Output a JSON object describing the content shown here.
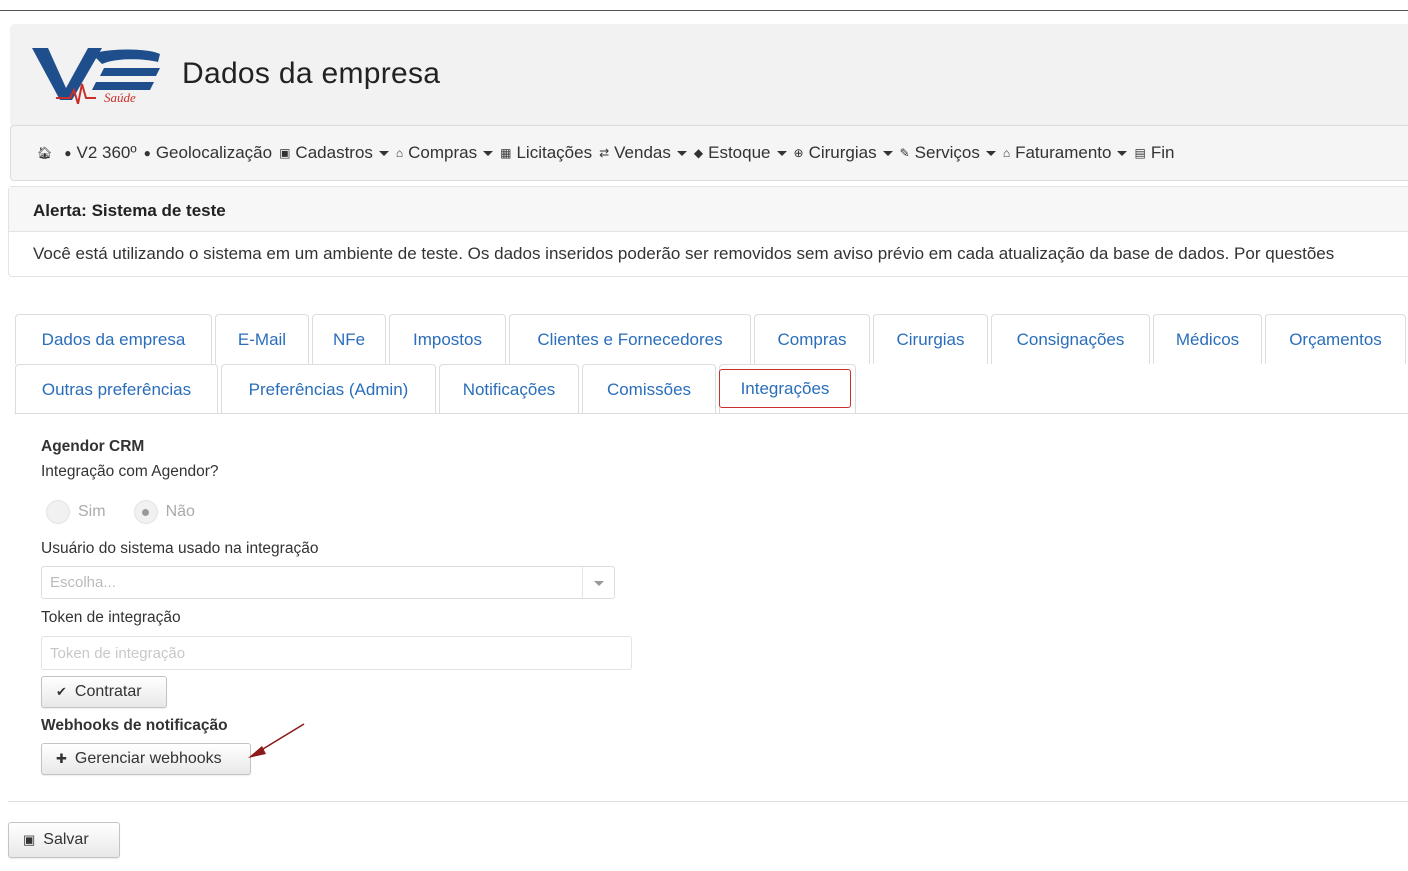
{
  "header": {
    "title": "Dados da empresa",
    "logo_text": "V2 Saúde"
  },
  "navbar": {
    "items": [
      {
        "icon": "home-icon",
        "label": ""
      },
      {
        "icon": "globe-icon",
        "label": "V2 360º"
      },
      {
        "icon": "globe-icon",
        "label": "Geolocalização"
      },
      {
        "icon": "save-icon",
        "label": "Cadastros"
      },
      {
        "icon": "bank-icon",
        "label": "Compras"
      },
      {
        "icon": "building-icon",
        "label": "Licitações"
      },
      {
        "icon": "transfer-icon",
        "label": "Vendas"
      },
      {
        "icon": "tag-icon",
        "label": "Estoque"
      },
      {
        "icon": "plus-circle-icon",
        "label": "Cirurgias"
      },
      {
        "icon": "wrench-icon",
        "label": "Serviços"
      },
      {
        "icon": "bank-icon",
        "label": "Faturamento"
      },
      {
        "icon": "table-icon",
        "label": "Fin"
      }
    ]
  },
  "alert": {
    "title": "Alerta: Sistema de teste",
    "message": "Você está utilizando o sistema em um ambiente de teste. Os dados inseridos poderão ser removidos sem aviso prévio em cada atualização da base de dados. Por questões"
  },
  "tabs": {
    "row1": [
      "Dados da empresa",
      "E-Mail",
      "NFe",
      "Impostos",
      "Clientes e Fornecedores",
      "Compras",
      "Cirurgias",
      "Consignações",
      "Médicos",
      "Orçamentos"
    ],
    "row2": [
      "Outras preferências",
      "Preferências (Admin)",
      "Notificações",
      "Comissões",
      "Integrações"
    ],
    "active": "Integrações"
  },
  "form": {
    "section_title": "Agendor CRM",
    "question": "Integração com Agendor?",
    "radio_yes": "Sim",
    "radio_no": "Não",
    "radio_selected": "Não",
    "user_label": "Usuário do sistema usado na integração",
    "user_placeholder": "Escolha...",
    "token_label": "Token de integração",
    "token_placeholder": "Token de integração",
    "hire_button": "Contratar",
    "webhooks_title": "Webhooks de notificação",
    "webhooks_button": "Gerenciar webhooks"
  },
  "footer": {
    "save_button": "Salvar"
  },
  "colors": {
    "link": "#2a6ebb",
    "active_tab_border": "#c9302c",
    "annotation_arrow": "#8b1a1a"
  }
}
